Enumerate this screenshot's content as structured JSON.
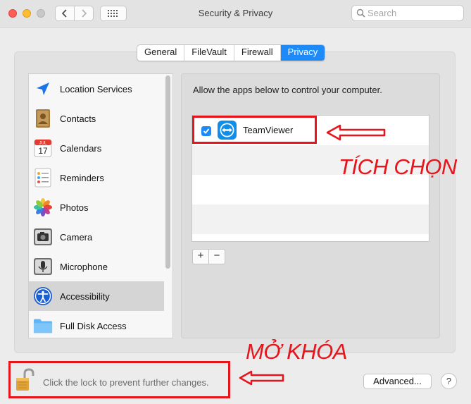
{
  "window": {
    "title": "Security & Privacy"
  },
  "search": {
    "placeholder": "Search"
  },
  "tabs": [
    {
      "label": "General",
      "active": false
    },
    {
      "label": "FileVault",
      "active": false
    },
    {
      "label": "Firewall",
      "active": false
    },
    {
      "label": "Privacy",
      "active": true
    }
  ],
  "sidebar": {
    "items": [
      {
        "label": "Location Services",
        "icon": "location-arrow-icon"
      },
      {
        "label": "Contacts",
        "icon": "contacts-book-icon"
      },
      {
        "label": "Calendars",
        "icon": "calendar-icon",
        "icon_text": "17",
        "icon_month": "JUL"
      },
      {
        "label": "Reminders",
        "icon": "reminders-icon"
      },
      {
        "label": "Photos",
        "icon": "photos-flower-icon"
      },
      {
        "label": "Camera",
        "icon": "camera-icon"
      },
      {
        "label": "Microphone",
        "icon": "microphone-icon"
      },
      {
        "label": "Accessibility",
        "icon": "accessibility-icon",
        "selected": true
      },
      {
        "label": "Full Disk Access",
        "icon": "folder-icon"
      }
    ]
  },
  "panel": {
    "description": "Allow the apps below to control your computer.",
    "apps": [
      {
        "name": "TeamViewer",
        "checked": true,
        "icon": "teamviewer-icon"
      }
    ],
    "add_label": "+",
    "remove_label": "−"
  },
  "footer": {
    "lock_text": "Click the lock to prevent further changes.",
    "advanced_label": "Advanced...",
    "help_label": "?"
  },
  "annotations": {
    "check_label": "TÍCH CHỌN",
    "unlock_label": "MỞ KHÓA"
  },
  "colors": {
    "accent": "#1d8af7",
    "annotation_red": "#e8141c"
  }
}
